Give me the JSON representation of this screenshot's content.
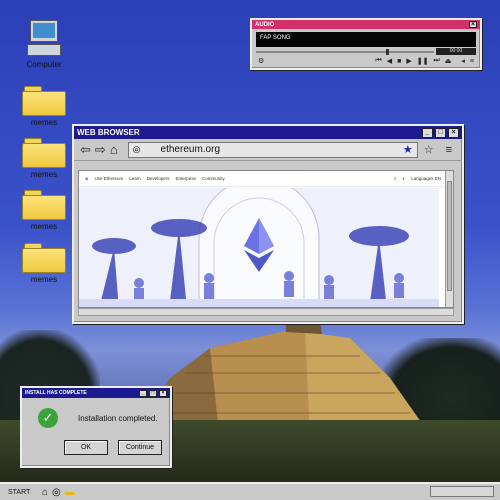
{
  "desktop": {
    "icons": [
      {
        "label": "Computer",
        "kind": "computer-icon"
      },
      {
        "label": "memes",
        "kind": "folder-icon"
      },
      {
        "label": "memes",
        "kind": "folder-icon"
      },
      {
        "label": "memes",
        "kind": "folder-icon"
      },
      {
        "label": "memes",
        "kind": "folder-icon"
      }
    ]
  },
  "audio": {
    "title": "AUDIO",
    "song": "FAP SONG",
    "time": "00:00",
    "progress": 0.73
  },
  "browser": {
    "title": "WEB BROWSER",
    "url": "ethereum.org",
    "site_nav": [
      "Use Ethereum",
      "Learn",
      "Developers",
      "Enterprise",
      "Community"
    ],
    "language": "Languages EN"
  },
  "dialog": {
    "title": "INSTALL HAS COMPLETE",
    "message": "Installation completed.",
    "ok": "OK",
    "continue": "Continue"
  },
  "taskbar": {
    "start": "START"
  },
  "colors": {
    "titlebar": "#1b1b8f",
    "audio_titlebar": "#d2306a",
    "sky": "#3a52c9"
  }
}
